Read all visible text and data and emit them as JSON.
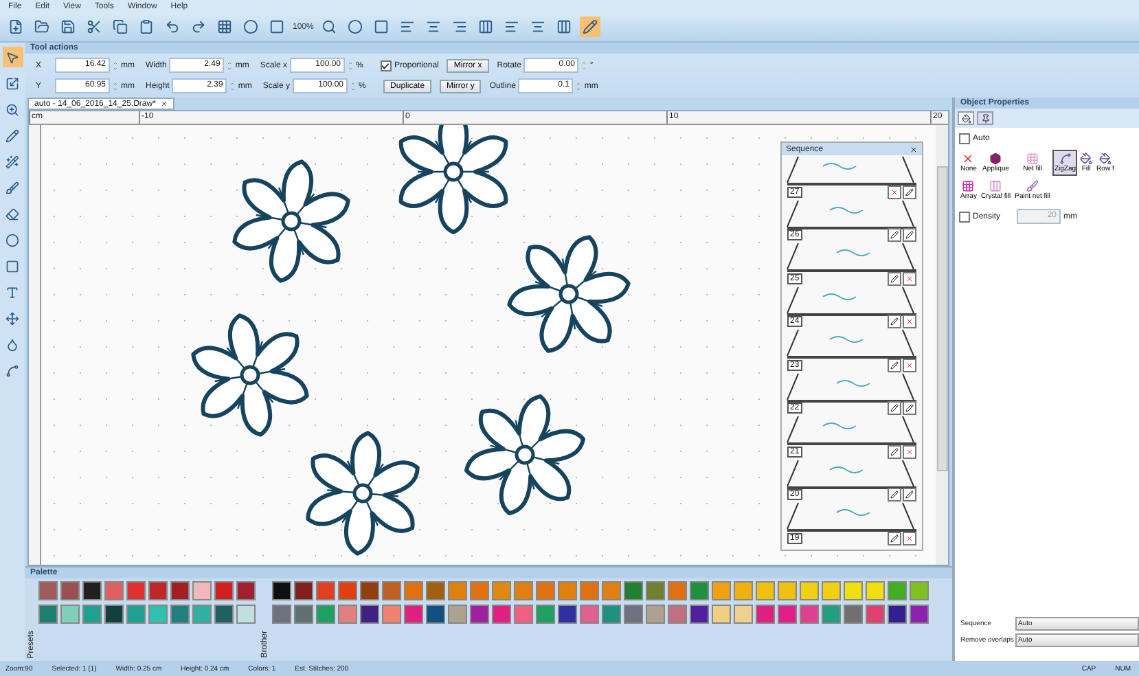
{
  "menu": [
    "File",
    "Edit",
    "View",
    "Tools",
    "Window",
    "Help"
  ],
  "toolbar": {
    "zoom": "100%"
  },
  "tool_options": {
    "title": "Tool actions",
    "rows": [
      [
        {
          "kind": "field",
          "label": "X",
          "value": "16.42",
          "unit": "mm"
        },
        {
          "kind": "field",
          "label": "Width",
          "value": "2.49",
          "unit": "mm"
        },
        {
          "kind": "field",
          "label": "Scale x",
          "value": "100.00",
          "unit": "%"
        },
        {
          "kind": "checkbox",
          "label": "Proportional",
          "checked": true
        },
        {
          "kind": "button",
          "label": "Mirror x"
        },
        {
          "kind": "field",
          "label": "Rotate",
          "value": "0.00",
          "unit": "°"
        }
      ],
      [
        {
          "kind": "field",
          "label": "Y",
          "value": "60.95",
          "unit": "mm"
        },
        {
          "kind": "field",
          "label": "Height",
          "value": "2.39",
          "unit": "mm"
        },
        {
          "kind": "field",
          "label": "Scale y",
          "value": "100.00",
          "unit": "%"
        },
        {
          "kind": "button",
          "label": "Duplicate"
        },
        {
          "kind": "button",
          "label": "Mirror y"
        },
        {
          "kind": "field",
          "label": "Outline",
          "value": "0.1",
          "unit": "mm"
        }
      ]
    ]
  },
  "document_tab": {
    "title": "auto - 14_06_2016_14_25.Draw*",
    "selected": true
  },
  "ruler": [
    "cm",
    "-10",
    "0",
    "10",
    "20"
  ],
  "sequence": {
    "title": "Sequence",
    "items": [
      {
        "number": "27",
        "actions": [
          {
            "kind": "remove"
          },
          {
            "kind": "edit"
          }
        ]
      },
      {
        "number": "26",
        "actions": [
          {
            "kind": "edit"
          },
          {
            "kind": "edit"
          }
        ]
      },
      {
        "number": "25",
        "actions": [
          {
            "kind": "edit"
          },
          {
            "kind": "remove"
          }
        ]
      },
      {
        "number": "24",
        "actions": [
          {
            "kind": "edit"
          },
          {
            "kind": "remove"
          }
        ]
      },
      {
        "number": "23",
        "actions": [
          {
            "kind": "edit"
          },
          {
            "kind": "remove"
          }
        ]
      },
      {
        "number": "22",
        "actions": [
          {
            "kind": "edit"
          },
          {
            "kind": "edit"
          }
        ]
      },
      {
        "number": "21",
        "actions": [
          {
            "kind": "edit"
          },
          {
            "kind": "remove"
          }
        ]
      },
      {
        "number": "20",
        "actions": [
          {
            "kind": "edit"
          },
          {
            "kind": "edit"
          }
        ]
      },
      {
        "number": "19",
        "actions": [
          {
            "kind": "edit"
          },
          {
            "kind": "remove"
          }
        ]
      }
    ]
  },
  "object_properties": {
    "title": "Object Properties",
    "tabs": [
      {
        "kind": "fill",
        "selected": true
      },
      {
        "kind": "needle",
        "selected": false
      }
    ],
    "auto": {
      "label": "Auto",
      "checked": false
    },
    "fill_types": [
      {
        "label": "None",
        "kind": "none",
        "selected": false
      },
      {
        "label": "Applique",
        "kind": "applique",
        "selected": false
      },
      {
        "label": "Net fill",
        "kind": "net",
        "selected": false
      },
      {
        "label": "ZigZag",
        "kind": "zigzag",
        "selected": true
      },
      {
        "label": "Fill",
        "kind": "fill",
        "selected": false
      },
      {
        "label": "Row f",
        "kind": "fill",
        "selected": false
      },
      {
        "label": "Array",
        "kind": "array",
        "selected": false
      },
      {
        "label": "Crystal fill",
        "kind": "crystal",
        "selected": false
      },
      {
        "label": "Paint net fill",
        "kind": "paint",
        "selected": false
      }
    ],
    "density": {
      "label": "Density",
      "checked": false,
      "value": "20",
      "unit": "mm",
      "disabled": true
    },
    "settings": [
      {
        "label": "Sequence",
        "value": "Auto"
      },
      {
        "label": "Remove overlaps",
        "value": "Auto"
      }
    ]
  },
  "palette": {
    "title": "Palette",
    "groups": [
      {
        "label": "Presets",
        "rows": [
          [
            {
              "color": "#a05a5a"
            },
            {
              "color": "#9a5050"
            },
            {
              "color": "#202020"
            },
            {
              "color": "#e06060"
            },
            {
              "color": "#e03030"
            },
            {
              "color": "#c02828"
            },
            {
              "color": "#a02020"
            },
            {
              "color": "#f0b8b8"
            },
            {
              "color": "#d02020"
            },
            {
              "color": "#a02030"
            }
          ],
          [
            {
              "color": "#208070"
            },
            {
              "color": "#80d0b8"
            },
            {
              "color": "#20a090"
            },
            {
              "color": "#104040"
            },
            {
              "color": "#20a090"
            },
            {
              "color": "#30c0b0"
            },
            {
              "color": "#208080"
            },
            {
              "color": "#30b0a0"
            },
            {
              "color": "#206060"
            },
            {
              "color": "#c0e0e0"
            }
          ]
        ]
      },
      {
        "label": "Brother",
        "rows": [
          [
            {
              "color": "#101010"
            },
            {
              "color": "#802020"
            },
            {
              "color": "#e04020"
            },
            {
              "color": "#e04010"
            },
            {
              "color": "#904010"
            },
            {
              "color": "#c06020"
            },
            {
              "color": "#e07010"
            },
            {
              "color": "#a06010"
            },
            {
              "color": "#e08010"
            },
            {
              "color": "#e07010"
            },
            {
              "color": "#e08810"
            },
            {
              "color": "#e08010"
            },
            {
              "color": "#e07010"
            },
            {
              "color": "#e08010"
            },
            {
              "color": "#e07010"
            },
            {
              "color": "#e08010"
            },
            {
              "color": "#208030"
            },
            {
              "color": "#708030"
            },
            {
              "color": "#e07010"
            },
            {
              "color": "#209040"
            },
            {
              "color": "#f0a010"
            },
            {
              "color": "#f0b010"
            },
            {
              "color": "#f0c010"
            },
            {
              "color": "#f0c010"
            },
            {
              "color": "#f0d010"
            },
            {
              "color": "#f0d010"
            },
            {
              "color": "#f0e010"
            },
            {
              "color": "#f0e010"
            },
            {
              "color": "#40b020"
            },
            {
              "color": "#80c020"
            }
          ],
          [
            {
              "color": "#707080"
            },
            {
              "color": "#607070"
            },
            {
              "color": "#20a060"
            },
            {
              "color": "#e08080"
            },
            {
              "color": "#402080"
            },
            {
              "color": "#f08070"
            },
            {
              "color": "#e02080"
            },
            {
              "color": "#105080"
            },
            {
              "color": "#b0a090"
            },
            {
              "color": "#a020a0"
            },
            {
              "color": "#e02080"
            },
            {
              "color": "#f06080"
            },
            {
              "color": "#20a060"
            },
            {
              "color": "#3030a0"
            },
            {
              "color": "#e06090"
            },
            {
              "color": "#209080"
            },
            {
              "color": "#707080"
            },
            {
              "color": "#b0a090"
            },
            {
              "color": "#c07080"
            },
            {
              "color": "#5020a0"
            },
            {
              "color": "#f0d080"
            },
            {
              "color": "#f0d090"
            },
            {
              "color": "#e02080"
            },
            {
              "color": "#e02088"
            },
            {
              "color": "#e04090"
            },
            {
              "color": "#20a080"
            },
            {
              "color": "#707070"
            },
            {
              "color": "#e04070"
            },
            {
              "color": "#302090"
            },
            {
              "color": "#9020b0"
            }
          ]
        ]
      }
    ]
  },
  "status_bar": {
    "items": [
      "Zoom:90",
      "Selected: 1 (1)",
      "Width: 0.25 cm",
      "Height: 0.24 cm",
      "Colors: 1",
      "Est. Stitches: 200"
    ],
    "indicators": [
      "CAP",
      "NUM"
    ]
  }
}
